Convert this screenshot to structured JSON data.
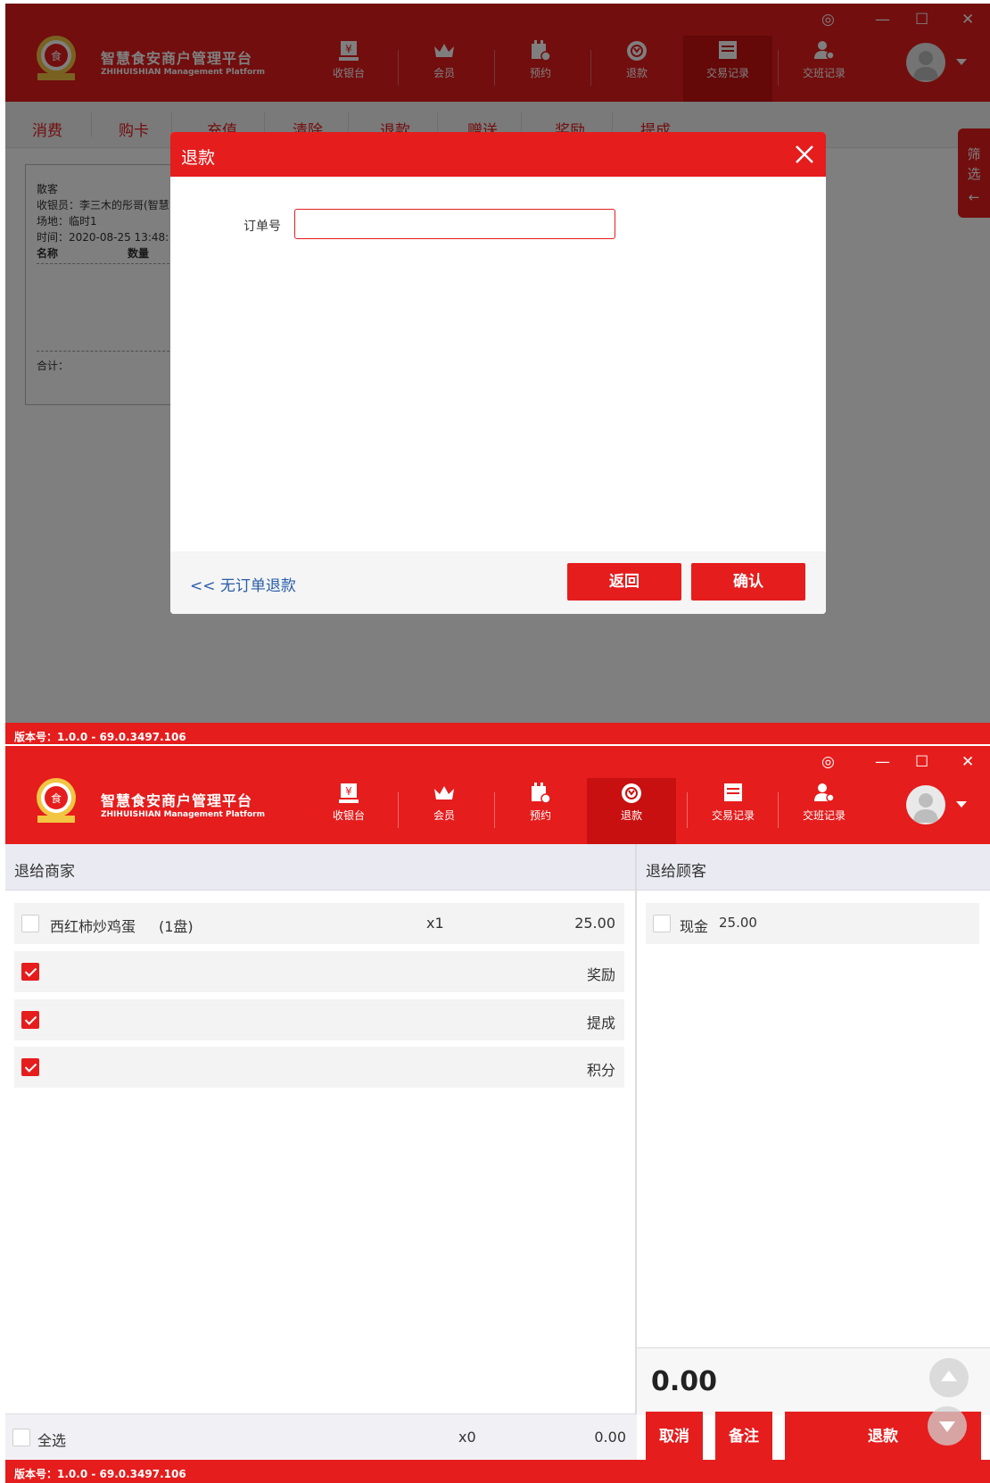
{
  "app": {
    "brand_cn": "智慧食安商户管理平台",
    "brand_en": "ZHIHUISHIAN Management Platform",
    "nav": [
      "收银台",
      "会员",
      "预约",
      "退款",
      "交易记录",
      "交班记录"
    ],
    "version": "版本号：1.0.0 - 69.0.3497.106"
  },
  "screen1": {
    "tabs": [
      "消费",
      "购卡",
      "充值",
      "清除",
      "退款",
      "赠送",
      "奖励",
      "提成"
    ],
    "receipt": {
      "customer": "散客",
      "cashier": "收银员：李三木的彤哥(智慧",
      "venue": "场地：临时1",
      "time": "时间：2020-08-25 13:48:",
      "col_name": "名称",
      "col_qty": "数量",
      "total": "合计："
    },
    "side_filter": "筛选",
    "dialog": {
      "title": "退款",
      "order_label": "订单号",
      "order_value": "",
      "no_order_link": "<< 无订单退款",
      "back": "返回",
      "confirm": "确认"
    }
  },
  "screen2": {
    "left_header": "退给商家",
    "right_header": "退给顾客",
    "item": {
      "name": "西红柿炒鸡蛋",
      "unit": "(1盘)",
      "qty": "x1",
      "price": "25.00"
    },
    "options": [
      {
        "label": "奖励",
        "checked": true
      },
      {
        "label": "提成",
        "checked": true
      },
      {
        "label": "积分",
        "checked": true
      }
    ],
    "cash": {
      "label": "现金",
      "amount": "25.00"
    },
    "total": "0.00",
    "select_all": "全选",
    "selected_qty": "x0",
    "selected_amount": "0.00",
    "cancel": "取消",
    "remark": "备注",
    "refund": "退款"
  },
  "colors": {
    "primary": "#e51d1d",
    "link": "#2a5ea8"
  }
}
